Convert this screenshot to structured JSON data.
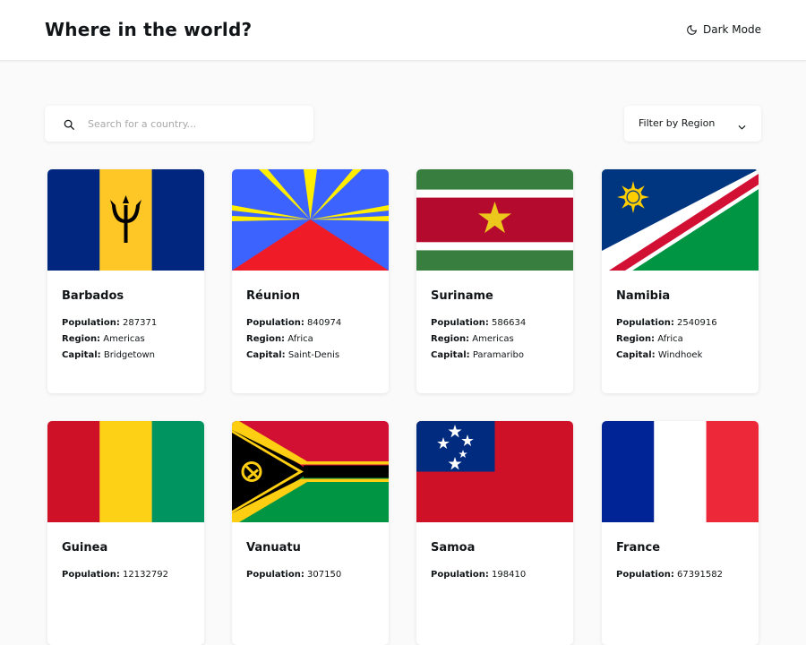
{
  "header": {
    "title": "Where in the world?",
    "mode_label": "Dark Mode",
    "mode_icon": "moon-icon"
  },
  "search": {
    "placeholder": "Search for a country...",
    "value": "",
    "icon": "search-icon"
  },
  "filter": {
    "label": "Filter by Region",
    "icon": "chevron-down-icon"
  },
  "labels": {
    "population": "Population:",
    "region": "Region:",
    "capital": "Capital:"
  },
  "countries": [
    {
      "name": "Barbados",
      "population": "287371",
      "region": "Americas",
      "capital": "Bridgetown",
      "flag": "barbados-flag"
    },
    {
      "name": "Réunion",
      "population": "840974",
      "region": "Africa",
      "capital": "Saint-Denis",
      "flag": "reunion-flag"
    },
    {
      "name": "Suriname",
      "population": "586634",
      "region": "Americas",
      "capital": "Paramaribo",
      "flag": "suriname-flag"
    },
    {
      "name": "Namibia",
      "population": "2540916",
      "region": "Africa",
      "capital": "Windhoek",
      "flag": "namibia-flag"
    },
    {
      "name": "Guinea",
      "population": "12132792",
      "region": "",
      "capital": "",
      "flag": "guinea-flag"
    },
    {
      "name": "Vanuatu",
      "population": "307150",
      "region": "",
      "capital": "",
      "flag": "vanuatu-flag"
    },
    {
      "name": "Samoa",
      "population": "198410",
      "region": "",
      "capital": "",
      "flag": "samoa-flag"
    },
    {
      "name": "France",
      "population": "67391582",
      "region": "",
      "capital": "",
      "flag": "france-flag"
    }
  ],
  "colors": {
    "background": "#fafafa",
    "element": "#ffffff",
    "text": "#111517",
    "placeholder": "#a8a8a8"
  }
}
